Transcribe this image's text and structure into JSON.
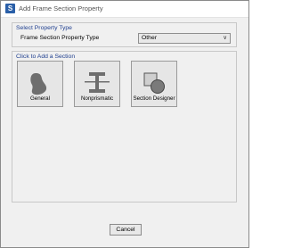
{
  "window": {
    "title": "Add Frame Section Property",
    "app_icon": "S"
  },
  "select_property_type": {
    "group_label": "Select Property Type",
    "field_label": "Frame Section Property Type",
    "selected_value": "Other"
  },
  "add_section": {
    "group_label": "Click to Add a Section",
    "buttons": [
      {
        "label": "General",
        "icon": "general-shape-icon"
      },
      {
        "label": "Nonprismatic",
        "icon": "nonprismatic-beam-icon"
      },
      {
        "label": "Section Designer",
        "icon": "section-designer-icon"
      }
    ]
  },
  "footer": {
    "cancel_label": "Cancel"
  },
  "colors": {
    "group_label": "#1f3f8f",
    "icon_fill": "#6e6e6e",
    "app_icon": "#2a5fa8"
  }
}
